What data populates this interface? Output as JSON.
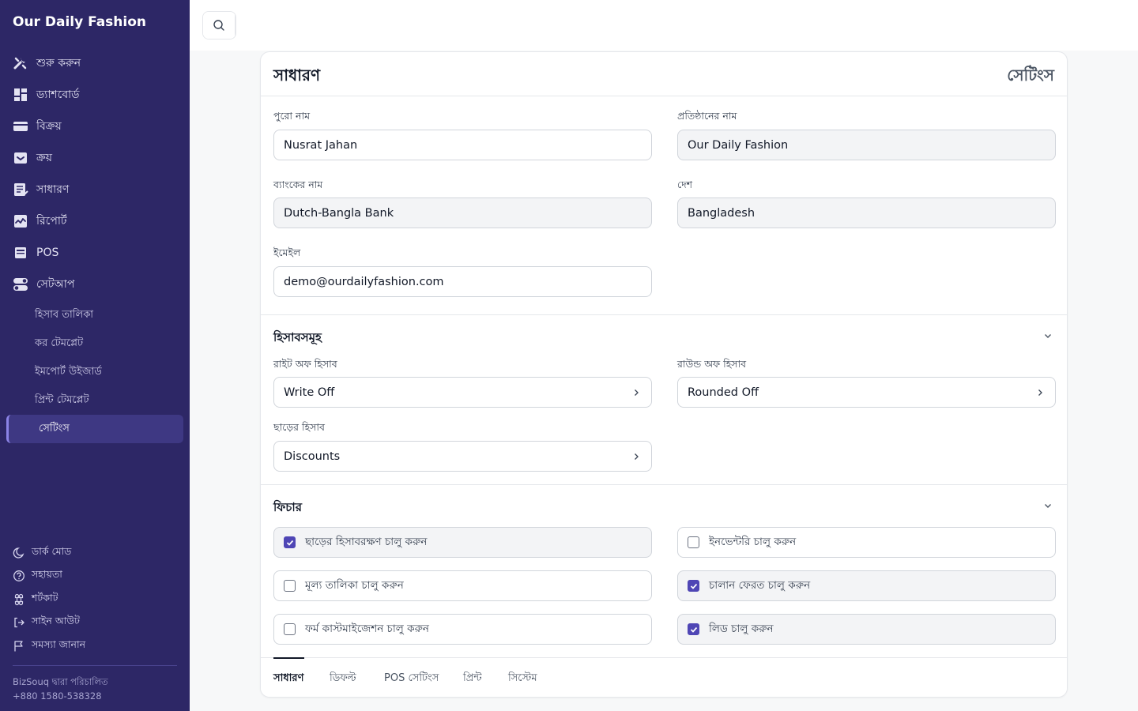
{
  "sidebar": {
    "brand": "Our Daily Fashion",
    "items": [
      {
        "label": "শুরু করুন",
        "icon": "tools-icon"
      },
      {
        "label": "ড্যাশবোর্ড",
        "icon": "dashboard-icon"
      },
      {
        "label": "বিক্রয়",
        "icon": "card-icon"
      },
      {
        "label": "ক্রয়",
        "icon": "inbox-icon"
      },
      {
        "label": "সাধারণ",
        "icon": "document-icon"
      },
      {
        "label": "রিপোর্ট",
        "icon": "chart-icon"
      },
      {
        "label": "POS",
        "icon": "pos-icon"
      },
      {
        "label": "সেটআপ",
        "icon": "toggle-icon"
      }
    ],
    "subitems": [
      "হিসাব তালিকা",
      "কর টেমপ্লেট",
      "ইমপোর্ট উইজার্ড",
      "প্রিন্ট টেমপ্লেট",
      "সেটিংস"
    ],
    "bottom": [
      {
        "label": "ডার্ক মোড",
        "icon": "moon-icon"
      },
      {
        "label": "সহায়তা",
        "icon": "help-icon"
      },
      {
        "label": "শর্টকাট",
        "icon": "command-icon"
      },
      {
        "label": "সাইন আউট",
        "icon": "logout-icon"
      },
      {
        "label": "সমস্যা জানান",
        "icon": "flag-icon"
      }
    ],
    "powered_by": "BizSouq দ্বারা পরিচালিত",
    "phone": "+880 1580-538328"
  },
  "card": {
    "title": "সাধারণ",
    "title_right": "সেটিংস",
    "general": {
      "full_name_label": "পুরো নাম",
      "full_name": "Nusrat Jahan",
      "company_label": "প্রতিষ্ঠানের নাম",
      "company": "Our Daily Fashion",
      "bank_label": "ব্যাংকের নাম",
      "bank": "Dutch-Bangla Bank",
      "country_label": "দেশ",
      "country": "Bangladesh",
      "email_label": "ইমেইল",
      "email": "demo@ourdailyfashion.com"
    },
    "accounts": {
      "title": "হিসাবসমূহ",
      "writeoff_label": "রাইট অফ হিসাব",
      "writeoff": "Write Off",
      "roundoff_label": "রাউন্ড অফ হিসাব",
      "roundoff": "Rounded Off",
      "discount_label": "ছাড়ের হিসাব",
      "discount": "Discounts"
    },
    "features": {
      "title": "ফিচার",
      "items": [
        {
          "label": "ছাড়ের হিসাবরক্ষণ চালু করুন",
          "checked": true
        },
        {
          "label": "ইনভেন্টরি চালু করুন",
          "checked": false
        },
        {
          "label": "মূল্য তালিকা চালু করুন",
          "checked": false
        },
        {
          "label": "চালান ফেরত চালু করুন",
          "checked": true
        },
        {
          "label": "ফর্ম কাস্টমাইজেশন চালু করুন",
          "checked": false
        },
        {
          "label": "লিড চালু করুন",
          "checked": true
        }
      ]
    },
    "tabs": [
      "সাধারণ",
      "ডিফল্ট",
      "POS সেটিংস",
      "প্রিন্ট",
      "সিস্টেম"
    ]
  }
}
